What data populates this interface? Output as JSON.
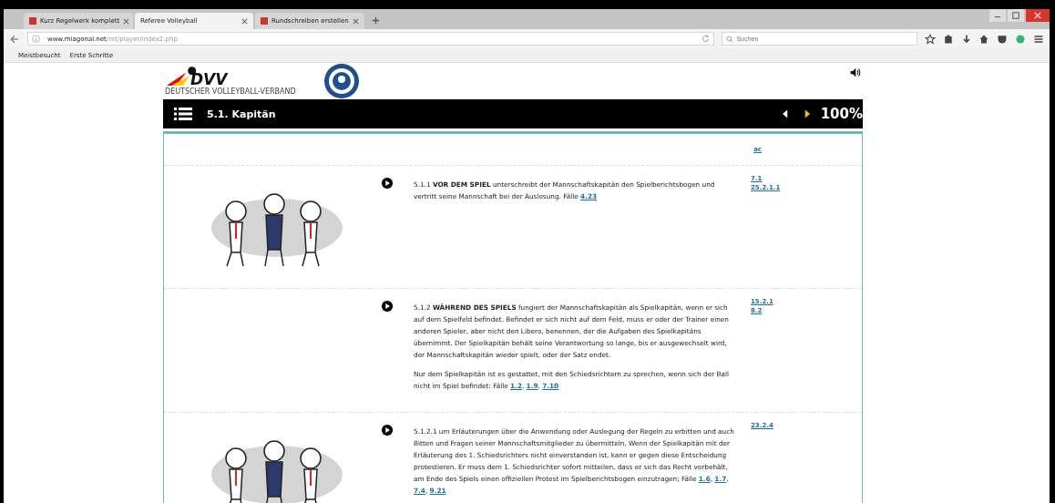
{
  "browser": {
    "tabs": [
      {
        "label": "Kurz Regelwerk komplett",
        "selected": false
      },
      {
        "label": "Referee Volleyball",
        "selected": true
      },
      {
        "label": "Rundschreiben erstellen",
        "selected": false
      }
    ],
    "url_host": "www.miagonal.net",
    "url_path": "/ret/player/index2.php",
    "search": {
      "placeholder": "Suchen"
    },
    "bookmarks": [
      "Meistbesucht",
      "Erste Schritte"
    ]
  },
  "header": {
    "logo_text": "DVV",
    "logo_subtitle": "DEUTSCHER VOLLEYBALL-VERBAND"
  },
  "toolbar": {
    "title": "5.1. Kapitän",
    "zoom": "100%"
  },
  "top_link": "ac",
  "case_separator": ", ",
  "rules": [
    {
      "illustration": true,
      "paragraphs": [
        {
          "text": "5.1.1 **VOR DEM SPIEL** unterschreibt der Mannschaftskapitän den Spielberichtsbogen und vertritt seine Mannschaft bei der Auslosung. Fälle",
          "cases": [
            "4.23"
          ]
        }
      ],
      "refs": [
        "7.1",
        "25.2.1.1"
      ]
    },
    {
      "illustration": false,
      "paragraphs": [
        {
          "text": "5.1.2 **WÄHREND DES SPIELS** fungiert der Mannschaftskapitän als Spielkapitän, wenn er sich auf dem Spielfeld befindet. Befindet er sich nicht auf dem Feld, muss er oder der Trainer einen anderen Spieler, aber nicht den Libero, benennen, der die Aufgaben des Spielkapitäns übernimmt. Der Spielkapitän behält seine Verantwortung so lange, bis er ausgewechselt wird, der Mannschaftskapitän wieder spielt, oder der Satz endet."
        },
        {
          "text": "Nur dem Spielkapitän ist es gestattet, mit den Schiedsrichtern zu sprechen, wenn sich der Ball nicht im Spiel befindet:  Fälle",
          "cases": [
            "1.2",
            "1.9",
            "7.10"
          ]
        }
      ],
      "refs": [
        "15.2.1",
        "8.2"
      ]
    },
    {
      "illustration": true,
      "paragraphs": [
        {
          "text": "5.1.2.1 um Erläuterungen über die Anwendung oder Auslegung der Regeln zu erbitten und auch Bitten und Fragen seiner Mannschaftsmitglieder zu übermitteln. Wenn der Spielkapitän mit der Erläuterung des 1. Schiedsrichters nicht einverstanden ist, kann er gegen diese Entscheidung protestieren. Er muss dem 1. Schiedsrichter sofort mitteilen, dass er sich das Recht vorbehält, am Ende des Spiels einen offiziellen Protest im Spielberichtsbogen einzutragen;  Fälle",
          "cases": [
            "1.6",
            "1.7",
            "7.4",
            "9.21"
          ]
        }
      ],
      "refs": [
        "23.2.4"
      ]
    }
  ]
}
